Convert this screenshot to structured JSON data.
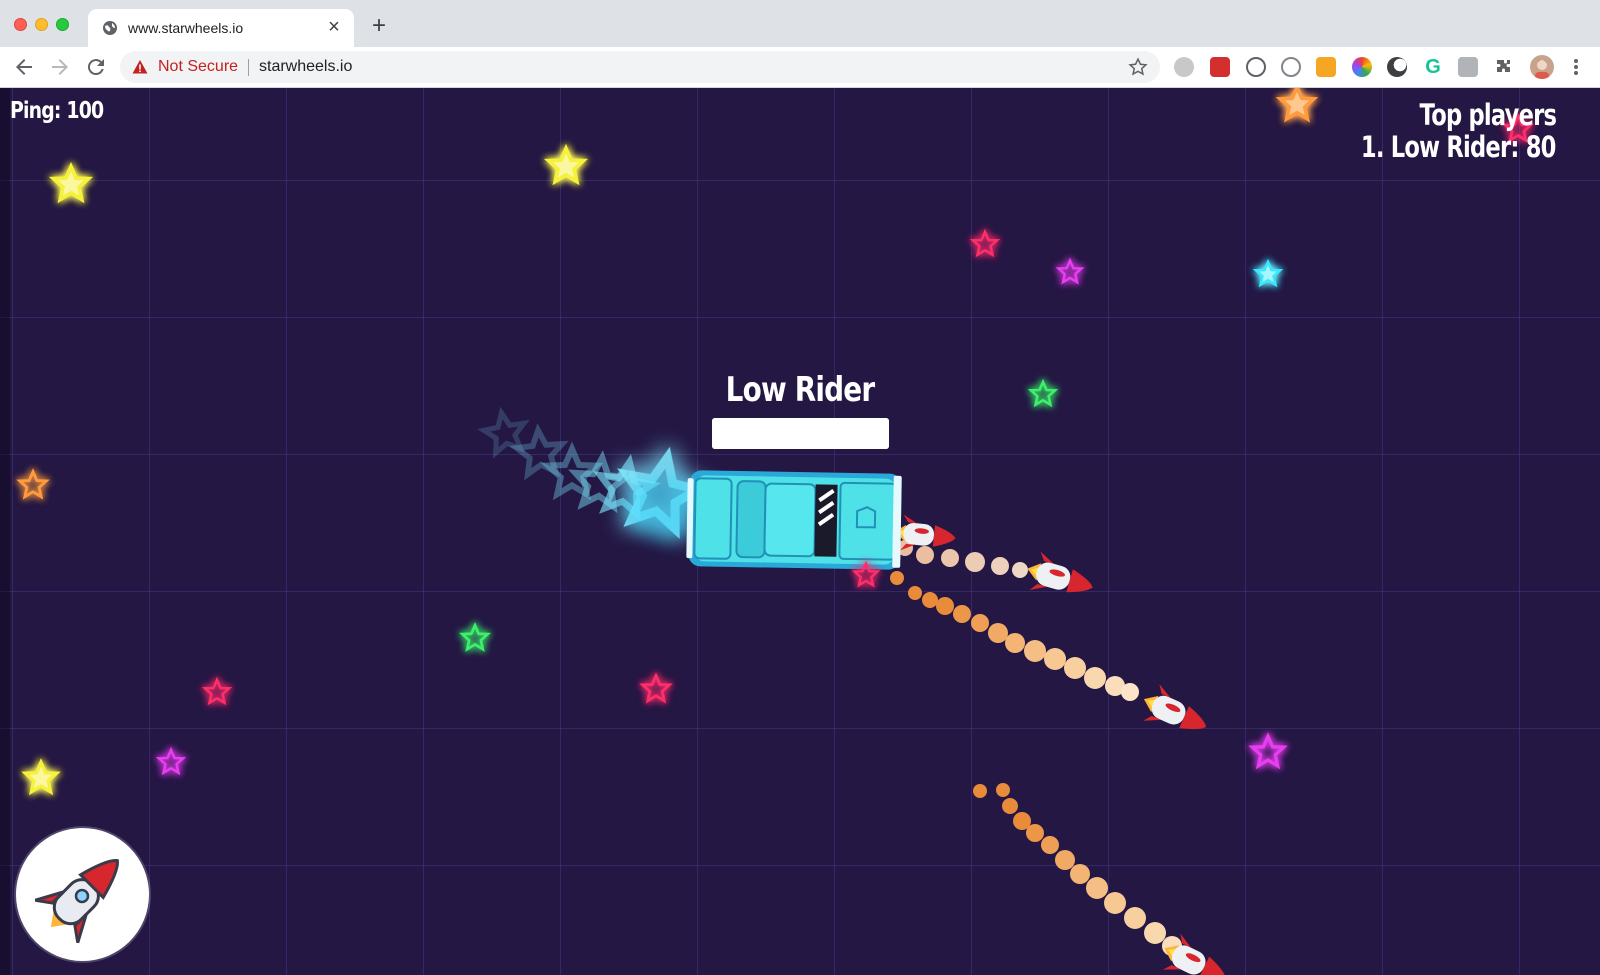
{
  "browser": {
    "tab": {
      "title": "www.starwheels.io",
      "favicon": "globe-icon"
    },
    "omnibox": {
      "security_label": "Not Secure",
      "url": "starwheels.io"
    },
    "extensions": [
      "abp-icon",
      "lastpass-icon",
      "code-brackets-icon",
      "no-tracking-icon",
      "stack-icon",
      "color-wheel-icon",
      "dark-mode-icon",
      "grammarly-icon",
      "css-viewer-icon",
      "puzzle-extensions-icon"
    ]
  },
  "game": {
    "ping_label": "Ping: 100",
    "leaderboard": {
      "title": "Top players",
      "entries": [
        "1. Low Rider: 80"
      ]
    },
    "player": {
      "name": "Low Rider",
      "boost_fraction": 1.0,
      "car_color": "#4fe1e8"
    },
    "powerup": {
      "icon": "rocket-icon"
    },
    "colors": {
      "background": "#241744",
      "grid": "#463782",
      "star_yellow": "#f6f13a",
      "star_red": "#ff2d6b",
      "star_magenta": "#e83cf0",
      "star_cyan": "#38e8ff",
      "star_green": "#3df06a",
      "star_orange": "#ff9a3d"
    }
  }
}
